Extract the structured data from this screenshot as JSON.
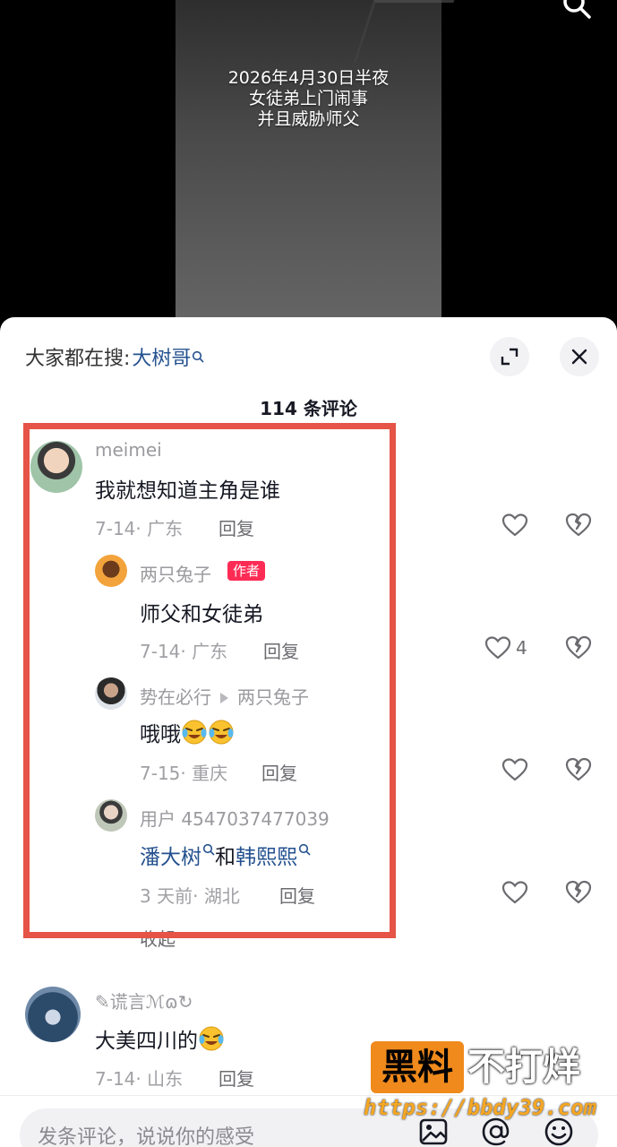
{
  "video": {
    "caption_line1": "2026年4月30日半夜",
    "caption_line2": "女徒弟上门闹事",
    "caption_line3": "并且威胁师父"
  },
  "sheet": {
    "search_label": "大家都在搜:",
    "search_keyword": "大树哥",
    "comment_count": "114 条评论"
  },
  "comments": [
    {
      "user": "meimei",
      "text": "我就想知道主角是谁",
      "date": "7-14",
      "location": "广东",
      "reply": "回复",
      "likes": ""
    },
    {
      "user": "两只兔子",
      "badge": "作者",
      "text": "师父和女徒弟",
      "date": "7-14",
      "location": "广东",
      "reply": "回复",
      "likes": "4"
    },
    {
      "user": "势在必行",
      "reply_to": "两只兔子",
      "text": "哦哦",
      "date": "7-15",
      "location": "重庆",
      "reply": "回复",
      "likes": ""
    },
    {
      "user": "用户 4547037477039",
      "text_link1": "潘大树",
      "text_mid": "和",
      "text_link2": "韩熙熙",
      "date": "3 天前",
      "location": "湖北",
      "reply": "回复",
      "likes": ""
    },
    {
      "user": "✎谎言ℳɷ↻",
      "text": "大美四川的",
      "date": "7-14",
      "location": "山东",
      "reply": "回复",
      "likes": ""
    }
  ],
  "collapse_label": "收起",
  "input": {
    "placeholder": "发条评论，说说你的感受"
  },
  "watermark": {
    "box_text": "黑料",
    "side_text": "不打烊",
    "url": "https://bbdy39.com"
  },
  "colors": {
    "highlight": "#e55446",
    "author_badge": "#fe2c55",
    "link_blue": "#24518f",
    "watermark_orange": "#f08a1c"
  }
}
